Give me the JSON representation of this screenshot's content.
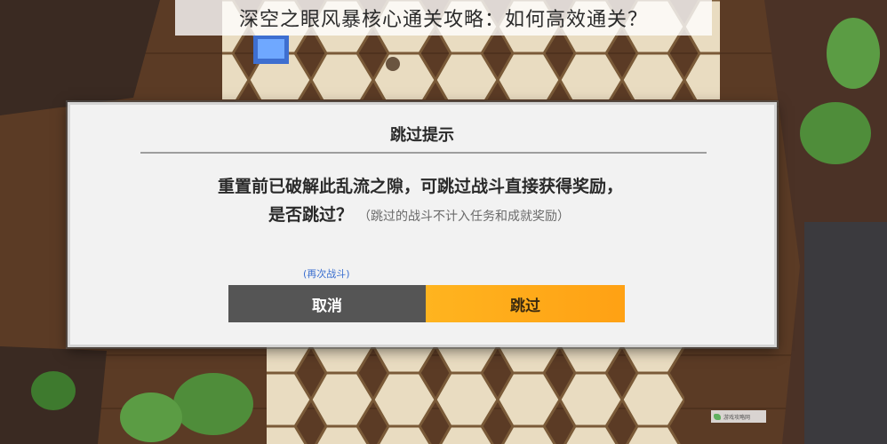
{
  "banner": {
    "title": "深空之眼风暴核心通关攻略：如何高效通关？"
  },
  "dialog": {
    "title": "跳过提示",
    "message_line1": "重置前已破解此乱流之隙，可跳过战斗直接获得奖励，",
    "message_line2": "是否跳过？",
    "note": "（跳过的战斗不计入任务和成就奖励）",
    "rebattle_link": "(再次战斗)",
    "cancel_label": "取消",
    "skip_label": "跳过"
  },
  "watermark": {
    "text": "游戏攻略网"
  },
  "colors": {
    "dialog_bg": "#f2f2f2",
    "cancel_bg": "#555555",
    "skip_bg": "#ffa114",
    "link": "#3b6fd0"
  }
}
